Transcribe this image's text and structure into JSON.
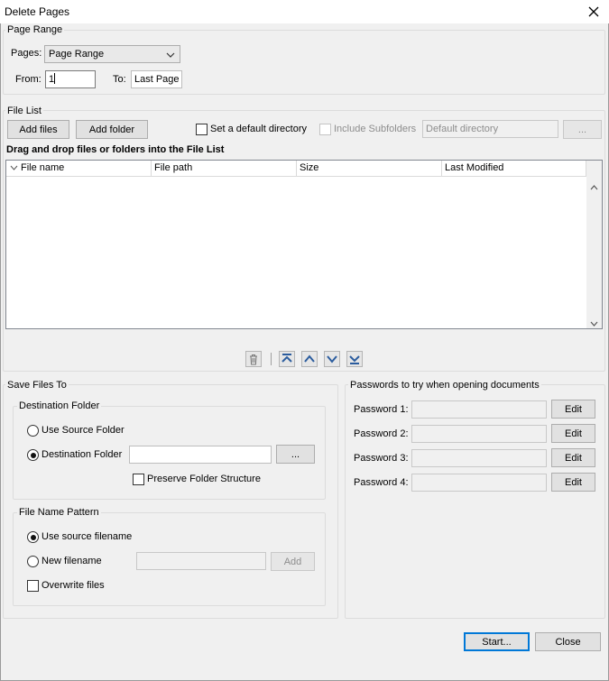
{
  "window": {
    "title": "Delete Pages"
  },
  "page_range": {
    "group_label": "Page Range",
    "pages_label": "Pages:",
    "pages_value": "Page Range",
    "from_label": "From:",
    "from_value": "1",
    "to_label": "To:",
    "to_value": "Last Page"
  },
  "file_list": {
    "group_label": "File List",
    "add_files": "Add files",
    "add_folder": "Add folder",
    "default_dir_label": "Set a default directory",
    "include_sub_label": "Include Subfolders",
    "default_dir_placeholder": "Default directory",
    "browse_label": "...",
    "drop_hint": "Drag and drop files or folders into the File List",
    "columns": [
      "File name",
      "File path",
      "Size",
      "Last Modified"
    ]
  },
  "save_files": {
    "group_label": "Save Files To",
    "dest_group_label": "Destination Folder",
    "use_source_folder": "Use Source Folder",
    "destination_folder": "Destination Folder",
    "browse_label": "...",
    "preserve_structure": "Preserve Folder Structure",
    "pattern_group_label": "File Name Pattern",
    "use_source_filename": "Use source filename",
    "new_filename": "New filename",
    "add_label": "Add",
    "overwrite_files": "Overwrite files"
  },
  "passwords": {
    "group_label": "Passwords to try when opening documents",
    "items": [
      {
        "label": "Password 1:",
        "edit": "Edit"
      },
      {
        "label": "Password 2:",
        "edit": "Edit"
      },
      {
        "label": "Password 3:",
        "edit": "Edit"
      },
      {
        "label": "Password 4:",
        "edit": "Edit"
      }
    ]
  },
  "footer": {
    "start": "Start...",
    "close": "Close"
  },
  "colors": {
    "accent": "#0078d7",
    "arrow_icon": "#2b5c9e"
  }
}
